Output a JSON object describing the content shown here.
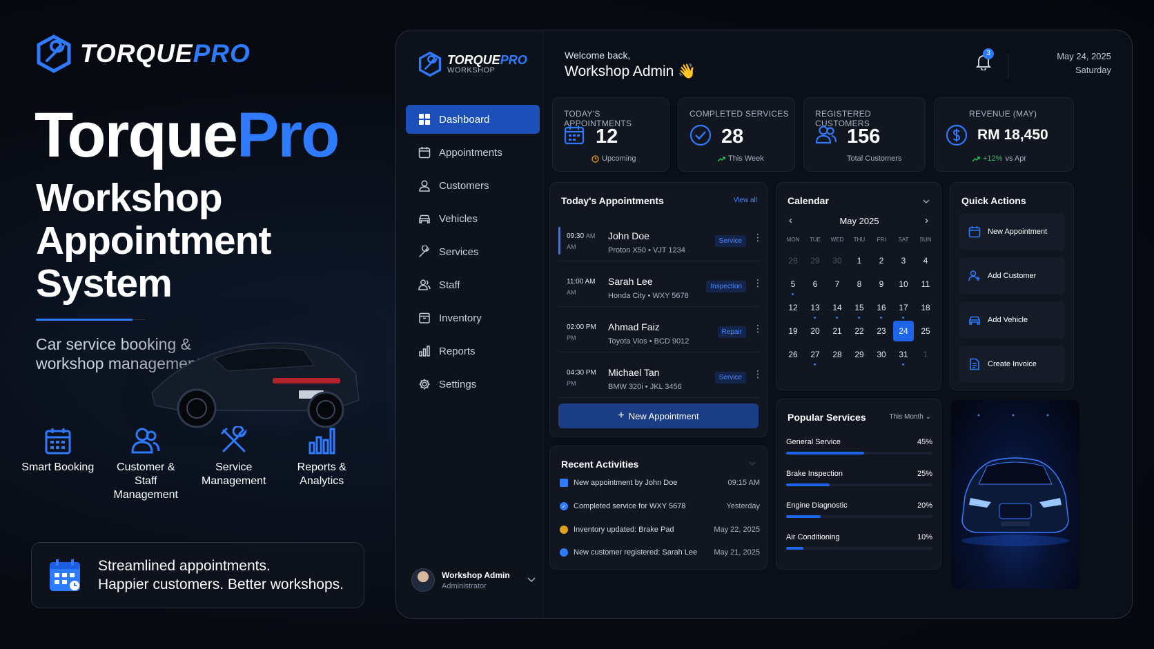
{
  "brand": {
    "name_a": "TORQUE",
    "name_b": "PRO",
    "accent": "#2f7bff"
  },
  "hero": {
    "title_a": "Torque",
    "title_b": "Pro",
    "sub_1": "Workshop",
    "sub_2": "Appointment",
    "sub_3": "System",
    "description": "Car service booking & workshop management"
  },
  "features": [
    {
      "icon": "calendar-icon",
      "label_1": "Smart Booking",
      "label_2": ""
    },
    {
      "icon": "users-icon",
      "label_1": "Customer &",
      "label_2": "Staff Management"
    },
    {
      "icon": "tools-icon",
      "label_1": "Service",
      "label_2": "Management"
    },
    {
      "icon": "bar-chart-icon",
      "label_1": "Reports &",
      "label_2": "Analytics"
    }
  ],
  "tagline": {
    "line_1": "Streamlined appointments.",
    "line_2": "Happier customers. Better workshops."
  },
  "sidebar": {
    "brand_a": "TORQUE",
    "brand_b": "PRO",
    "brand_sub": "WORKSHOP",
    "items": [
      {
        "label": "Dashboard",
        "icon": "grid-icon",
        "active": true
      },
      {
        "label": "Appointments",
        "icon": "calendar-icon"
      },
      {
        "label": "Customers",
        "icon": "user-icon"
      },
      {
        "label": "Vehicles",
        "icon": "car-icon"
      },
      {
        "label": "Services",
        "icon": "wrench-icon"
      },
      {
        "label": "Staff",
        "icon": "users-icon"
      },
      {
        "label": "Inventory",
        "icon": "box-icon"
      },
      {
        "label": "Reports",
        "icon": "bar-chart-icon"
      },
      {
        "label": "Settings",
        "icon": "gear-icon"
      }
    ],
    "user": {
      "name": "Workshop Admin",
      "role": "Administrator"
    }
  },
  "header": {
    "welcome": "Welcome back,",
    "name": "Workshop Admin",
    "wave": "👋",
    "notifications": "3",
    "date": "May 24, 2025",
    "day": "Saturday"
  },
  "stats": [
    {
      "label": "TODAY'S APPOINTMENTS",
      "value": "12",
      "sub": "Upcoming",
      "icon": "calendar-icon"
    },
    {
      "label": "COMPLETED SERVICES",
      "value": "28",
      "sub": "This Week",
      "icon": "check-circle-icon"
    },
    {
      "label": "REGISTERED CUSTOMERS",
      "value": "156",
      "sub": "Total Customers",
      "icon": "users-icon"
    },
    {
      "label": "REVENUE (MAY)",
      "value": "RM 18,450",
      "sub_a": "+12%",
      "sub_b": "vs Apr",
      "icon": "dollar-icon"
    }
  ],
  "appointments": {
    "title": "Today's Appointments",
    "view_all": "View all",
    "items": [
      {
        "time": "09:30",
        "ampm_a": "AM",
        "ampm": "AM",
        "name": "John Doe",
        "vehicle": "Proton X50 • VJT 1234",
        "tag": "Service"
      },
      {
        "time": "11:00 AM",
        "ampm_a": "",
        "ampm": "AM",
        "name": "Sarah Lee",
        "vehicle": "Honda City • WXY 5678",
        "tag": "Inspection"
      },
      {
        "time": "02:00 PM",
        "ampm_a": "",
        "ampm": "PM",
        "name": "Ahmad Faiz",
        "vehicle": "Toyota Vios • BCD 9012",
        "tag": "Repair"
      },
      {
        "time": "04:30 PM",
        "ampm_a": "",
        "ampm": "PM",
        "name": "Michael Tan",
        "vehicle": "BMW 320i • JKL 3456",
        "tag": "Service"
      }
    ],
    "new_button": "New Appointment"
  },
  "calendar": {
    "title": "Calendar",
    "month": "May 2025",
    "weekdays": [
      "MON",
      "TUE",
      "WED",
      "THU",
      "FRI",
      "SAT",
      "SUN"
    ],
    "weeks": [
      [
        "28",
        "29",
        "30",
        "1",
        "2",
        "3",
        "4"
      ],
      [
        "5",
        "6",
        "7",
        "8",
        "9",
        "10",
        "11"
      ],
      [
        "12",
        "13",
        "14",
        "15",
        "16",
        "17",
        "18"
      ],
      [
        "19",
        "20",
        "21",
        "22",
        "23",
        "24",
        "25"
      ],
      [
        "26",
        "27",
        "28",
        "29",
        "30",
        "31",
        "1"
      ]
    ],
    "selected": "24"
  },
  "quick_actions": {
    "title": "Quick Actions",
    "items": [
      {
        "label": "New Appointment",
        "icon": "calendar-icon"
      },
      {
        "label": "Add Customer",
        "icon": "user-plus-icon"
      },
      {
        "label": "Add Vehicle",
        "icon": "car-icon"
      },
      {
        "label": "Create Invoice",
        "icon": "document-icon"
      }
    ]
  },
  "activities": {
    "title": "Recent Activities",
    "items": [
      {
        "text": "New appointment by John Doe",
        "time": "09:15 AM",
        "color": "#2f7bff"
      },
      {
        "text": "Completed service for WXY 5678",
        "time": "Yesterday",
        "color": "#2f7bff"
      },
      {
        "text": "Inventory updated: Brake Pad",
        "time": "May 22, 2025",
        "color": "#e0a21b"
      },
      {
        "text": "New customer registered: Sarah Lee",
        "time": "May 21, 2025",
        "color": "#2f7bff"
      }
    ]
  },
  "popular_services": {
    "title": "Popular Services",
    "period": "This Month",
    "items": [
      {
        "name": "General Service",
        "pct": "45%",
        "value": 0.45
      },
      {
        "name": "Brake Inspection",
        "pct": "25%",
        "value": 0.25
      },
      {
        "name": "Engine Diagnostic",
        "pct": "20%",
        "value": 0.2
      },
      {
        "name": "Air Conditioning",
        "pct": "10%",
        "value": 0.1
      }
    ]
  }
}
